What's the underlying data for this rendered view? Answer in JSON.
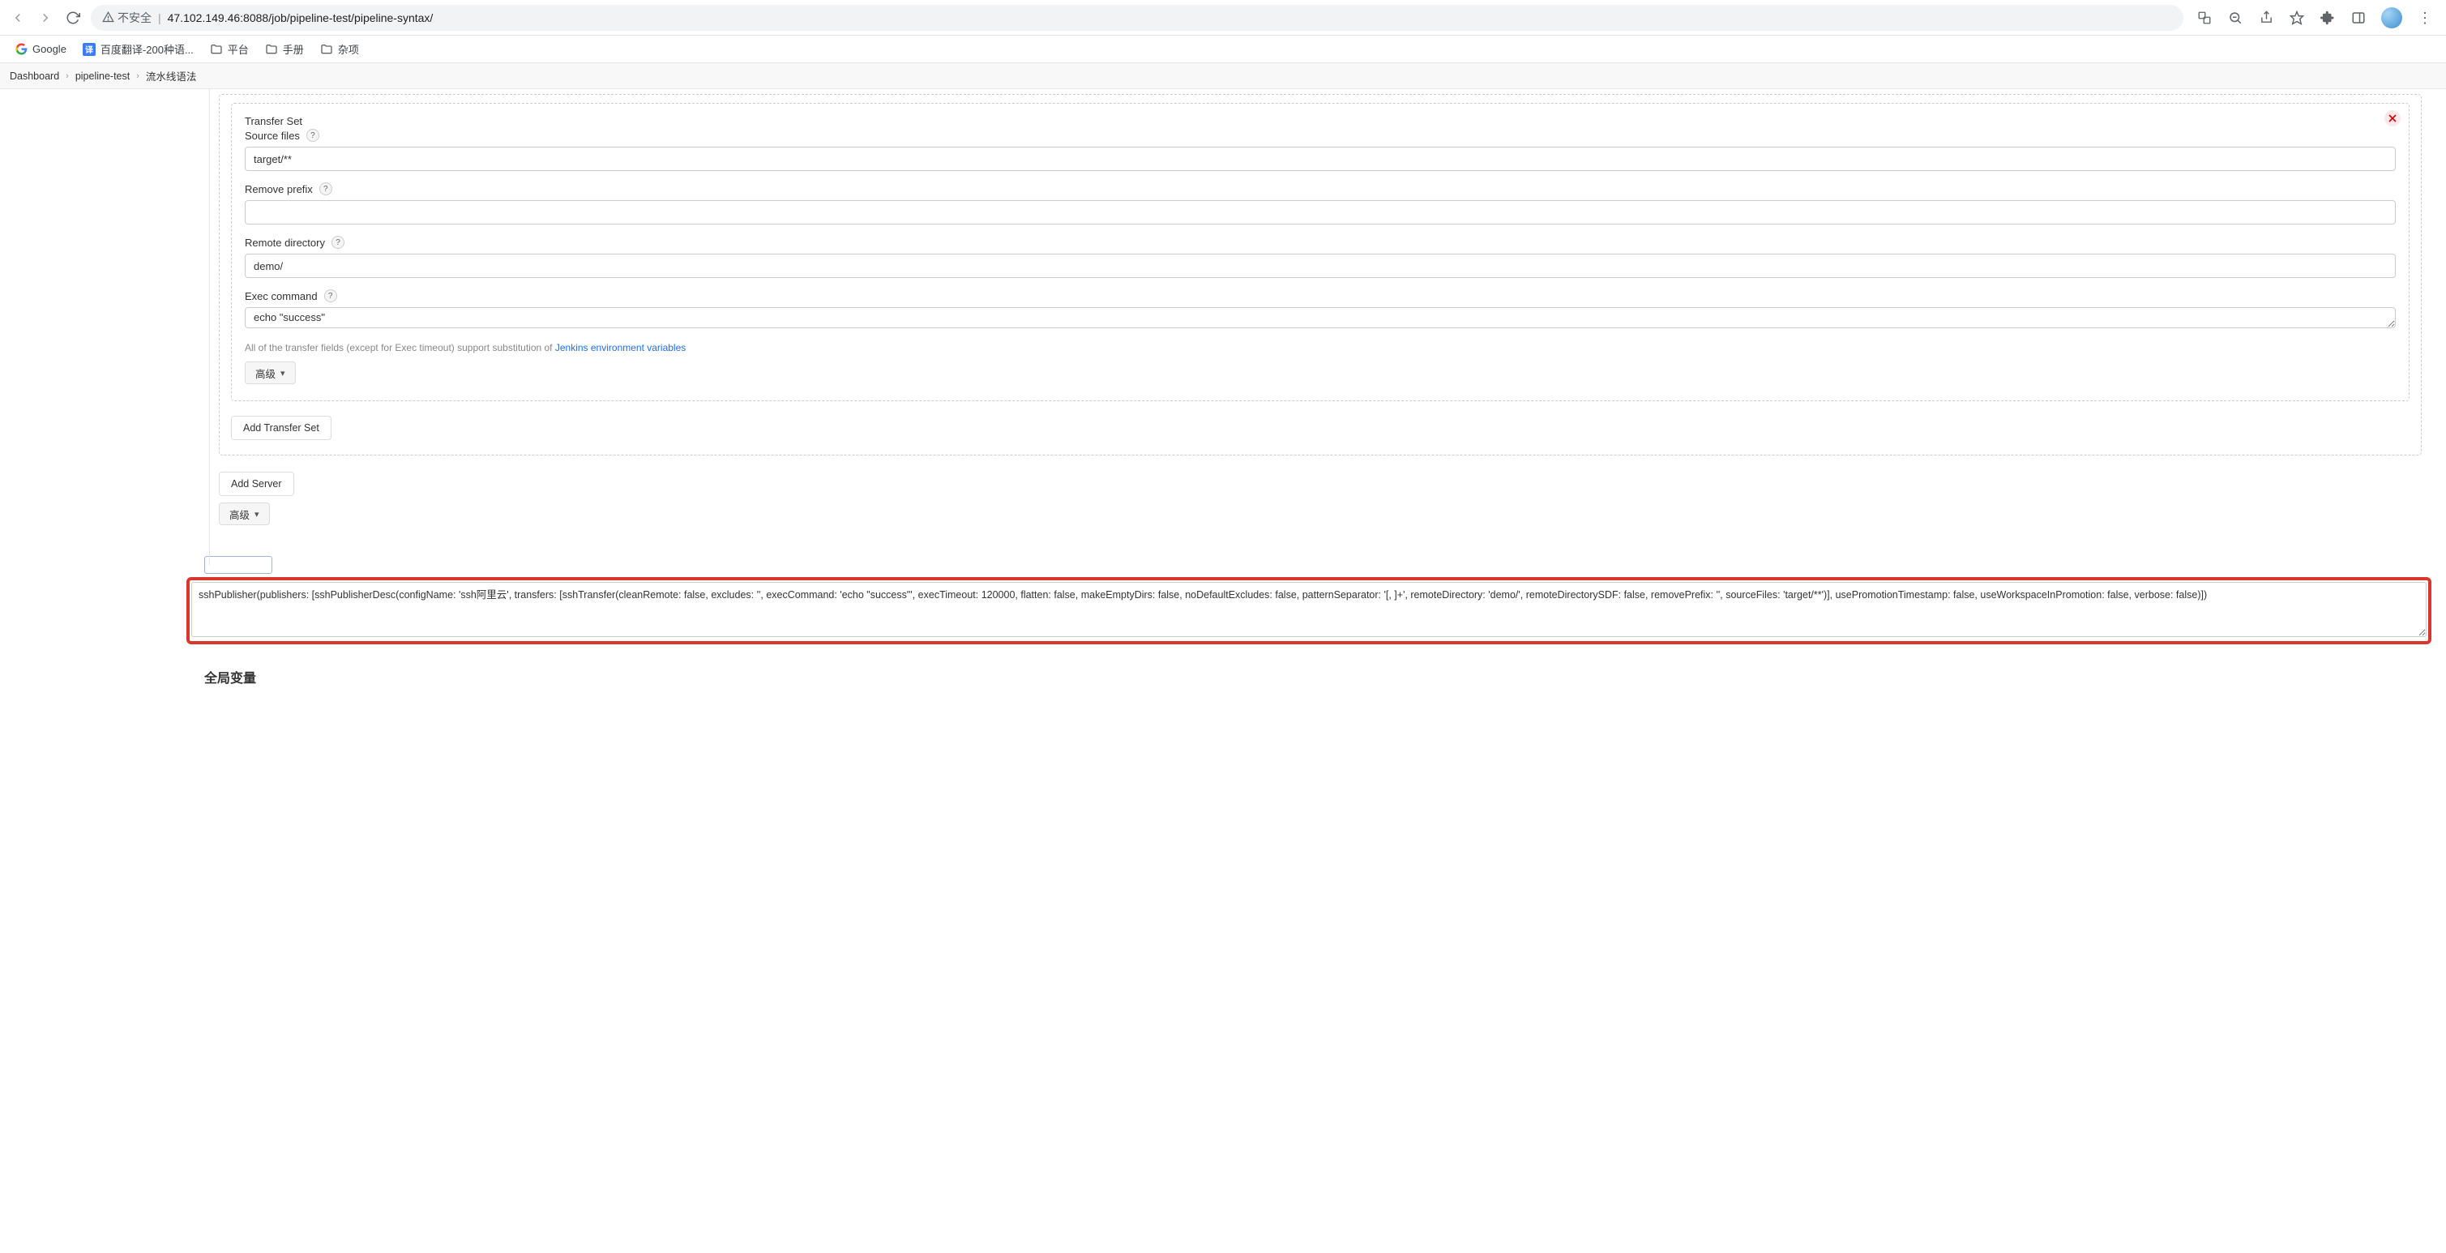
{
  "browser": {
    "notSecure": "不安全",
    "url": "47.102.149.46:8088/job/pipeline-test/pipeline-syntax/"
  },
  "bookmarks": {
    "google": "Google",
    "baidu": "百度翻译-200种语...",
    "platform": "平台",
    "manual": "手册",
    "misc": "杂项"
  },
  "breadcrumb": {
    "dashboard": "Dashboard",
    "job": "pipeline-test",
    "page": "流水线语法"
  },
  "transferSet": {
    "title": "Transfer Set",
    "sourceFilesLabel": "Source files",
    "sourceFilesValue": "target/**",
    "removePrefixLabel": "Remove prefix",
    "removePrefixValue": "",
    "remoteDirLabel": "Remote directory",
    "remoteDirValue": "demo/",
    "execCmdLabel": "Exec command",
    "execCmdValue": "echo \"success\"",
    "hintPrefix": "All of the transfer fields (except for Exec timeout) support substitution of ",
    "hintLink": "Jenkins environment variables",
    "advanced": "高级"
  },
  "buttons": {
    "addTransferSet": "Add Transfer Set",
    "addServer": "Add Server",
    "advanced2": "高级"
  },
  "output": {
    "value": "sshPublisher(publishers: [sshPublisherDesc(configName: 'ssh阿里云', transfers: [sshTransfer(cleanRemote: false, excludes: '', execCommand: 'echo \"success\"', execTimeout: 120000, flatten: false, makeEmptyDirs: false, noDefaultExcludes: false, patternSeparator: '[, ]+', remoteDirectory: 'demo/', remoteDirectorySDF: false, removePrefix: '', sourceFiles: 'target/**')], usePromotionTimestamp: false, useWorkspaceInPromotion: false, verbose: false)])"
  },
  "sections": {
    "globals": "全局变量"
  }
}
